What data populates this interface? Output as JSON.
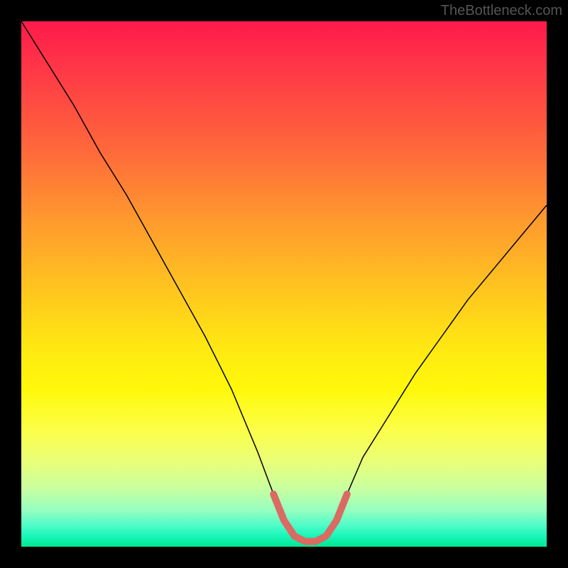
{
  "watermark": "TheBottleneck.com",
  "chart_data": {
    "type": "line",
    "title": "",
    "xlabel": "",
    "ylabel": "",
    "xlim": [
      0,
      100
    ],
    "ylim": [
      0,
      100
    ],
    "x": [
      0,
      5,
      10,
      15,
      20,
      25,
      30,
      35,
      40,
      45,
      48,
      50,
      52,
      54,
      56,
      58,
      60,
      62,
      65,
      70,
      75,
      80,
      85,
      90,
      95,
      100
    ],
    "values": [
      100,
      92,
      84,
      75,
      67,
      58,
      49,
      40,
      30,
      18,
      10,
      5,
      2,
      1,
      1,
      2,
      5,
      10,
      17,
      25,
      33,
      40,
      47,
      53,
      59,
      65
    ],
    "marker_segment": {
      "comment": "thick salmon segment along the trough",
      "x": [
        48,
        50,
        52,
        54,
        56,
        58,
        60,
        62
      ],
      "values": [
        10,
        5,
        2,
        1,
        1,
        2,
        5,
        10
      ],
      "color": "#d96b63"
    },
    "gradient_colors_top_to_bottom": [
      "#ff1a4b",
      "#ff6a3a",
      "#ffc81e",
      "#fff80a",
      "#c8ffa0",
      "#18f6b8",
      "#00e892"
    ]
  }
}
